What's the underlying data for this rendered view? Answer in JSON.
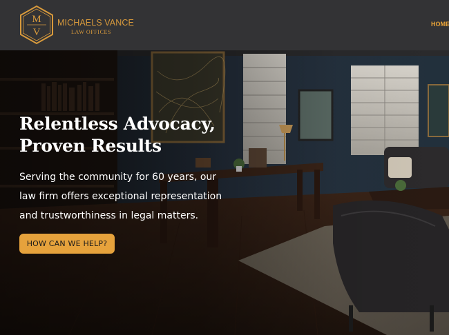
{
  "brand": {
    "monogram": "MV",
    "name": "MICHAELS VANCE",
    "subtitle": "LAW OFFICES",
    "accent_color": "#d89a3c"
  },
  "nav": {
    "items": [
      {
        "label": "HOME"
      }
    ]
  },
  "hero": {
    "headline_line1": "Relentless Advocacy,",
    "headline_line2": "Proven Results",
    "subtext_line1": "Serving the community for 60 years, our",
    "subtext_line2": "law firm offers exceptional representation",
    "subtext_line3": "and trustworthiness in legal matters.",
    "cta_label": "HOW CAN WE HELP?",
    "cta_color": "#e6a23c"
  }
}
